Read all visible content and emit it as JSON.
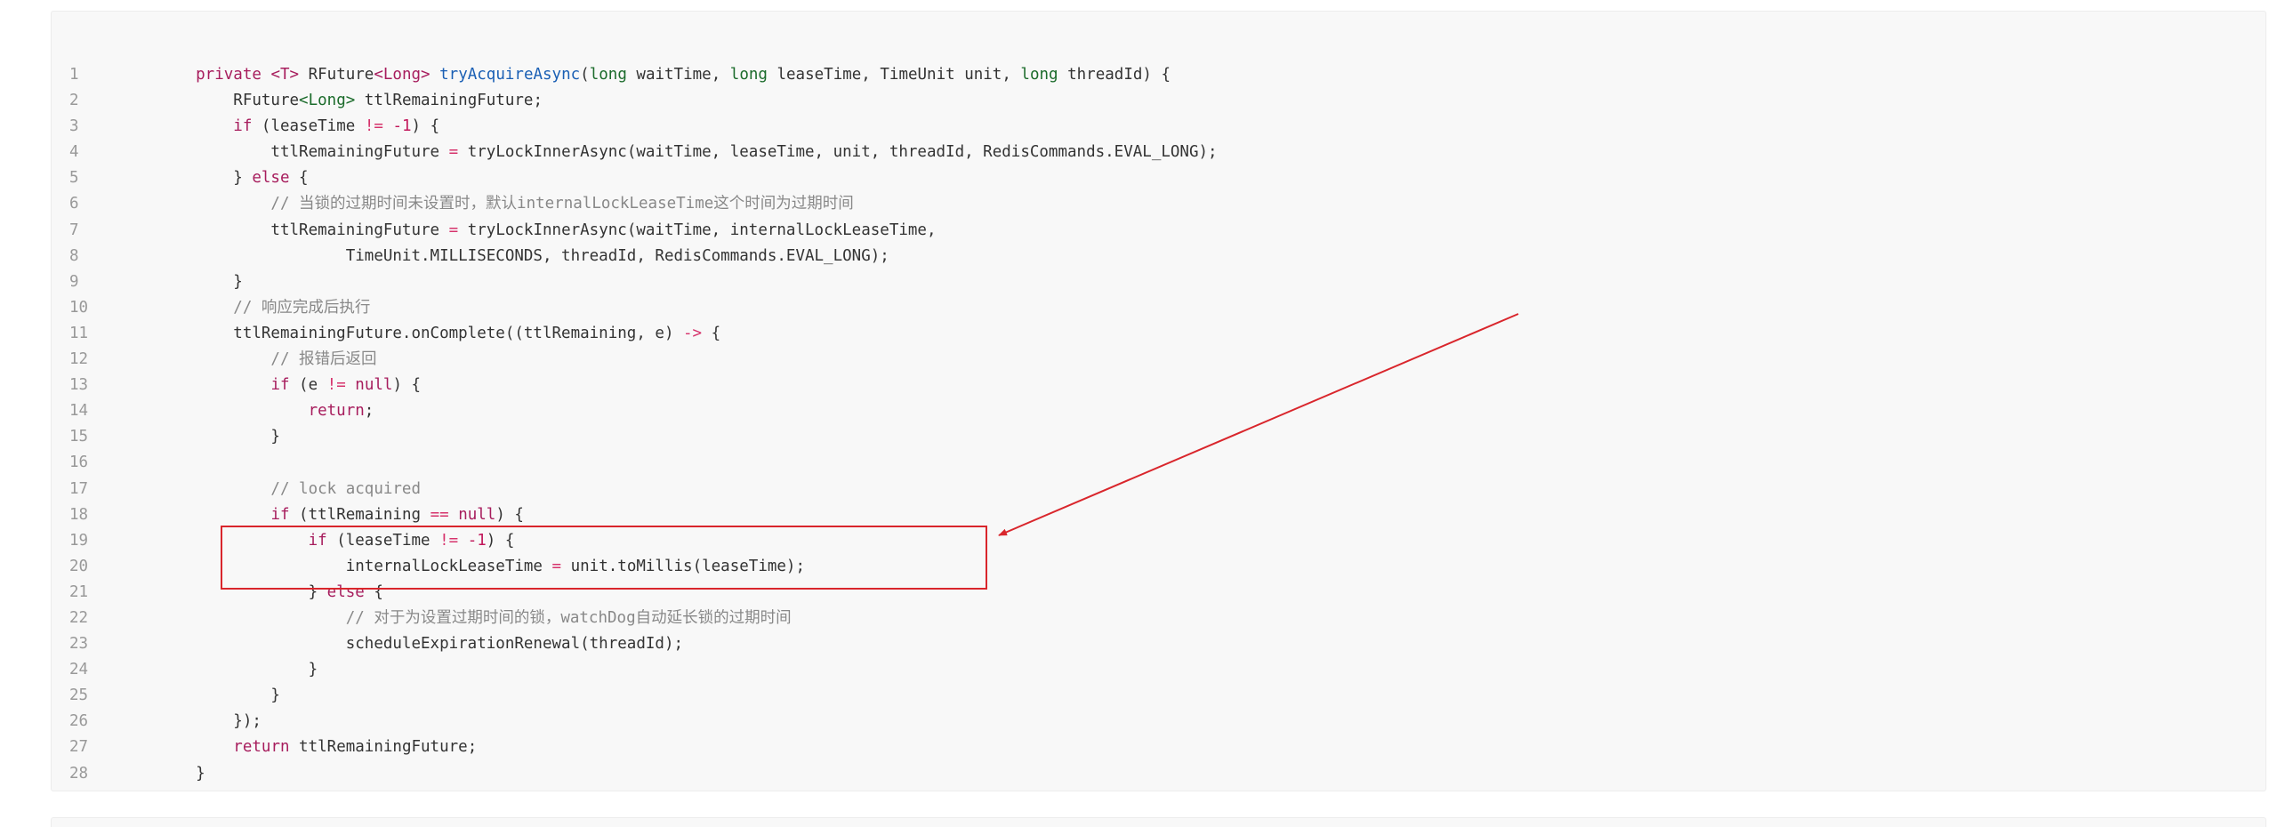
{
  "code": {
    "lines": [
      {
        "number": "1",
        "segments": [
          {
            "t": "    private ",
            "c": "kw"
          },
          {
            "t": "<T> ",
            "c": "kw"
          },
          {
            "t": "RFuture",
            "c": "tx"
          },
          {
            "t": "<Long> ",
            "c": "kw"
          },
          {
            "t": "tryAcquireAsync",
            "c": "fn"
          },
          {
            "t": "(",
            "c": "tx"
          },
          {
            "t": "long",
            "c": "type"
          },
          {
            "t": " waitTime, ",
            "c": "tx"
          },
          {
            "t": "long",
            "c": "type"
          },
          {
            "t": " leaseTime, TimeUnit unit, ",
            "c": "tx"
          },
          {
            "t": "long",
            "c": "type"
          },
          {
            "t": " threadId) {",
            "c": "tx"
          }
        ]
      },
      {
        "number": "2",
        "segments": [
          {
            "t": "        RFuture",
            "c": "tx"
          },
          {
            "t": "<Long>",
            "c": "type"
          },
          {
            "t": " ttlRemainingFuture;",
            "c": "tx"
          }
        ]
      },
      {
        "number": "3",
        "segments": [
          {
            "t": "        ",
            "c": "tx"
          },
          {
            "t": "if",
            "c": "kw"
          },
          {
            "t": " (leaseTime ",
            "c": "tx"
          },
          {
            "t": "!=",
            "c": "op"
          },
          {
            "t": " ",
            "c": "tx"
          },
          {
            "t": "-1",
            "c": "num"
          },
          {
            "t": ") {",
            "c": "tx"
          }
        ]
      },
      {
        "number": "4",
        "segments": [
          {
            "t": "            ttlRemainingFuture ",
            "c": "tx"
          },
          {
            "t": "=",
            "c": "op"
          },
          {
            "t": " tryLockInnerAsync(waitTime, leaseTime, unit, threadId, RedisCommands.EVAL_LONG);",
            "c": "tx"
          }
        ]
      },
      {
        "number": "5",
        "segments": [
          {
            "t": "        } ",
            "c": "tx"
          },
          {
            "t": "else",
            "c": "kw"
          },
          {
            "t": " {",
            "c": "tx"
          }
        ]
      },
      {
        "number": "6",
        "segments": [
          {
            "t": "            // 当锁的过期时间未设置时，默认internalLockLeaseTime这个时间为过期时间",
            "c": "cm"
          }
        ]
      },
      {
        "number": "7",
        "segments": [
          {
            "t": "            ttlRemainingFuture ",
            "c": "tx"
          },
          {
            "t": "=",
            "c": "op"
          },
          {
            "t": " tryLockInnerAsync(waitTime, internalLockLeaseTime,",
            "c": "tx"
          }
        ]
      },
      {
        "number": "8",
        "segments": [
          {
            "t": "                    TimeUnit.MILLISECONDS, threadId, RedisCommands.EVAL_LONG);",
            "c": "tx"
          }
        ]
      },
      {
        "number": "9",
        "segments": [
          {
            "t": "        }",
            "c": "tx"
          }
        ]
      },
      {
        "number": "10",
        "segments": [
          {
            "t": "        // 响应完成后执行",
            "c": "cm"
          }
        ]
      },
      {
        "number": "11",
        "segments": [
          {
            "t": "        ttlRemainingFuture.onComplete((ttlRemaining, e) ",
            "c": "tx"
          },
          {
            "t": "->",
            "c": "op"
          },
          {
            "t": " {",
            "c": "tx"
          }
        ]
      },
      {
        "number": "12",
        "segments": [
          {
            "t": "            // 报错后返回",
            "c": "cm"
          }
        ]
      },
      {
        "number": "13",
        "segments": [
          {
            "t": "            ",
            "c": "tx"
          },
          {
            "t": "if",
            "c": "kw"
          },
          {
            "t": " (e ",
            "c": "tx"
          },
          {
            "t": "!=",
            "c": "op"
          },
          {
            "t": " ",
            "c": "tx"
          },
          {
            "t": "null",
            "c": "kw"
          },
          {
            "t": ") {",
            "c": "tx"
          }
        ]
      },
      {
        "number": "14",
        "segments": [
          {
            "t": "                ",
            "c": "tx"
          },
          {
            "t": "return",
            "c": "kw"
          },
          {
            "t": ";",
            "c": "tx"
          }
        ]
      },
      {
        "number": "15",
        "segments": [
          {
            "t": "            }",
            "c": "tx"
          }
        ]
      },
      {
        "number": "16",
        "segments": [
          {
            "t": "",
            "c": "tx"
          }
        ]
      },
      {
        "number": "17",
        "segments": [
          {
            "t": "            // lock acquired",
            "c": "cm"
          }
        ]
      },
      {
        "number": "18",
        "segments": [
          {
            "t": "            ",
            "c": "tx"
          },
          {
            "t": "if",
            "c": "kw"
          },
          {
            "t": " (ttlRemaining ",
            "c": "tx"
          },
          {
            "t": "==",
            "c": "op"
          },
          {
            "t": " ",
            "c": "tx"
          },
          {
            "t": "null",
            "c": "kw"
          },
          {
            "t": ") {",
            "c": "tx"
          }
        ]
      },
      {
        "number": "19",
        "segments": [
          {
            "t": "                ",
            "c": "tx"
          },
          {
            "t": "if",
            "c": "kw"
          },
          {
            "t": " (leaseTime ",
            "c": "tx"
          },
          {
            "t": "!=",
            "c": "op"
          },
          {
            "t": " ",
            "c": "tx"
          },
          {
            "t": "-1",
            "c": "num"
          },
          {
            "t": ") {",
            "c": "tx"
          }
        ]
      },
      {
        "number": "20",
        "segments": [
          {
            "t": "                    internalLockLeaseTime ",
            "c": "tx"
          },
          {
            "t": "=",
            "c": "op"
          },
          {
            "t": " unit.toMillis(leaseTime);",
            "c": "tx"
          }
        ]
      },
      {
        "number": "21",
        "segments": [
          {
            "t": "                } ",
            "c": "tx"
          },
          {
            "t": "else",
            "c": "kw"
          },
          {
            "t": " {",
            "c": "tx"
          }
        ]
      },
      {
        "number": "22",
        "segments": [
          {
            "t": "                    // 对于为设置过期时间的锁，watchDog自动延长锁的过期时间",
            "c": "cm"
          }
        ]
      },
      {
        "number": "23",
        "segments": [
          {
            "t": "                    scheduleExpirationRenewal(threadId);",
            "c": "tx"
          }
        ]
      },
      {
        "number": "24",
        "segments": [
          {
            "t": "                }",
            "c": "tx"
          }
        ]
      },
      {
        "number": "25",
        "segments": [
          {
            "t": "            }",
            "c": "tx"
          }
        ]
      },
      {
        "number": "26",
        "segments": [
          {
            "t": "        });",
            "c": "tx"
          }
        ]
      },
      {
        "number": "27",
        "segments": [
          {
            "t": "        ",
            "c": "tx"
          },
          {
            "t": "return",
            "c": "kw"
          },
          {
            "t": " ttlRemainingFuture;",
            "c": "tx"
          }
        ]
      },
      {
        "number": "28",
        "segments": [
          {
            "t": "    }",
            "c": "tx"
          }
        ]
      }
    ]
  },
  "annotation": {
    "color": "#d9262c"
  }
}
